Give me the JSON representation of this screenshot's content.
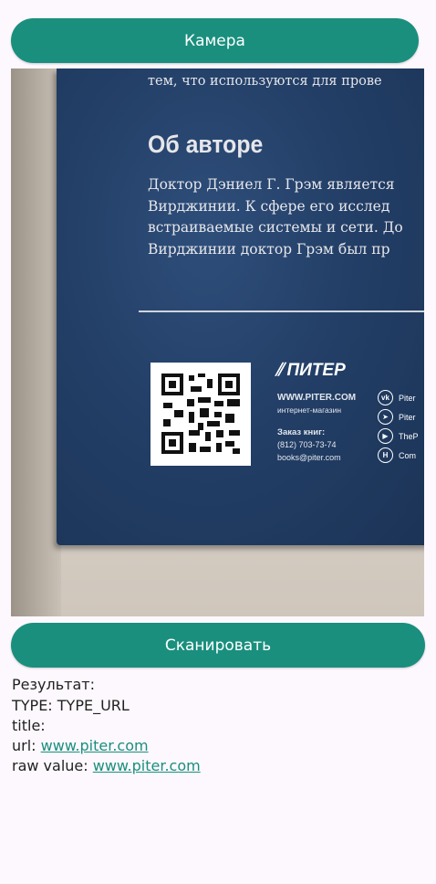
{
  "buttons": {
    "camera": "Камера",
    "scan": "Сканировать"
  },
  "photo": {
    "line_top": "тем, что используются для прове",
    "heading": "Об авторе",
    "paragraph": [
      "Доктор Дэниел Г. Грэм является",
      "Вирджинии. К сфере его исслед",
      "встраиваемые системы и сети. До",
      "Вирджинии доктор Грэм был пр"
    ],
    "brand": "ПИТЕР",
    "site": "WWW.PITER.COM",
    "shop": "интернет-магазин",
    "order": "Заказ книг:",
    "phone": "(812) 703-73-74",
    "email": "books@piter.com",
    "social": [
      {
        "icon": "vk-icon",
        "glyph": "vk",
        "text": "Piter"
      },
      {
        "icon": "telegram-icon",
        "glyph": "➤",
        "text": "Piter"
      },
      {
        "icon": "play-icon",
        "glyph": "▶",
        "text": "TheP"
      },
      {
        "icon": "h-icon",
        "glyph": "H",
        "text": "Com"
      }
    ]
  },
  "result": {
    "label": "Результат:",
    "type_line": "TYPE: TYPE_URL",
    "title_label": "title:",
    "url_label": "url:",
    "url_value": "www.piter.com",
    "raw_label": "raw value:",
    "raw_value": "www.piter.com"
  },
  "colors": {
    "accent": "#1a8f7e",
    "background": "#fdf8fd"
  }
}
